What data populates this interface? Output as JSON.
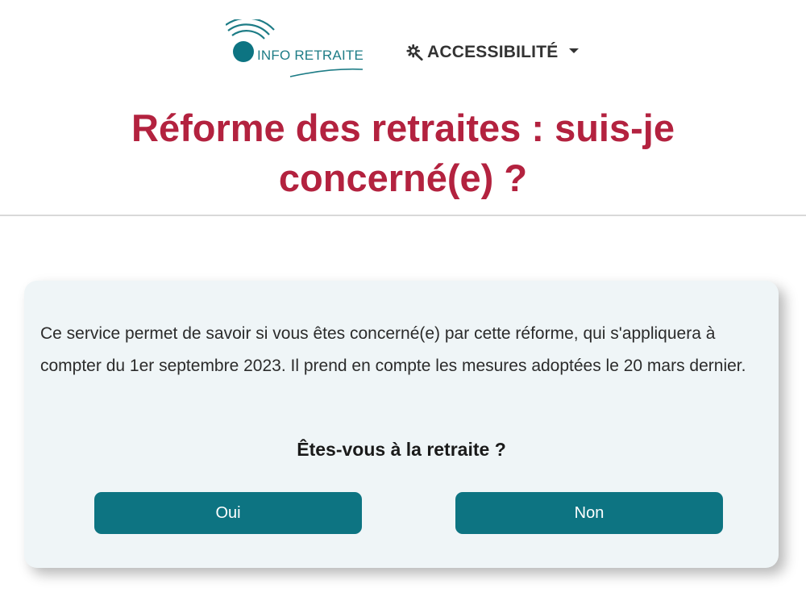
{
  "header": {
    "logo_text": "INFO RETRAITE",
    "accessibility_label": "ACCESSIBILITÉ",
    "title": "Réforme des retraites : suis-je concerné(e) ?"
  },
  "card": {
    "intro": "Ce service permet de savoir si vous êtes concerné(e) par cette réforme, qui s'appliquera à compter du 1er septembre 2023. Il prend en compte les mesures adoptées le 20 mars dernier.",
    "question": "Êtes-vous à la retraite ?",
    "yes_label": "Oui",
    "no_label": "Non"
  },
  "icons": {
    "logo": "signal-waves-logo",
    "accessibility": "gear-wrench-icon",
    "dropdown": "caret-down-icon"
  },
  "colors": {
    "title": "#b3223f",
    "brand_teal": "#0d7482",
    "card_background": "#eff5f7",
    "logo_teal": "#1d7c86"
  }
}
